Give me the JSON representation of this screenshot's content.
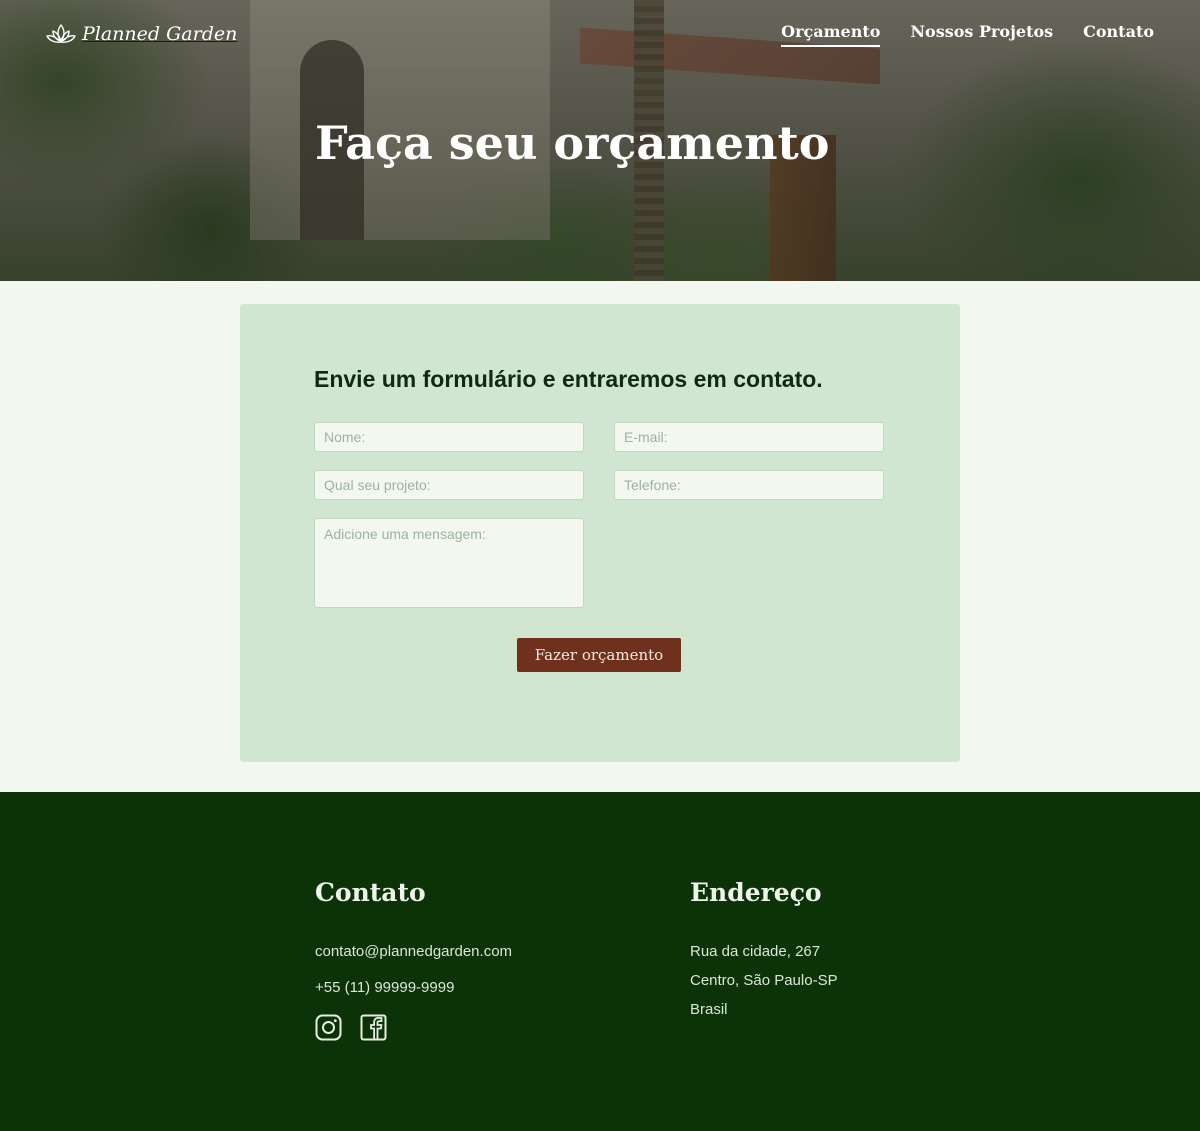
{
  "brand": {
    "name": "Planned Garden",
    "logo_icon": "lotus-icon"
  },
  "nav": {
    "items": [
      {
        "label": "Orçamento",
        "active": true
      },
      {
        "label": "Nossos Projetos",
        "active": false
      },
      {
        "label": "Contato",
        "active": false
      }
    ]
  },
  "hero": {
    "title": "Faça seu orçamento"
  },
  "form": {
    "heading": "Envie um formulário e entraremos em contato.",
    "fields": {
      "name": {
        "placeholder": "Nome:",
        "value": ""
      },
      "email": {
        "placeholder": "E-mail:",
        "value": ""
      },
      "project": {
        "placeholder": "Qual seu projeto:",
        "value": ""
      },
      "phone": {
        "placeholder": "Telefone:",
        "value": ""
      },
      "message": {
        "placeholder": "Adicione uma mensagem:",
        "value": ""
      }
    },
    "submit_label": "Fazer orçamento"
  },
  "footer": {
    "contact": {
      "title": "Contato",
      "email": "contato@plannedgarden.com",
      "phone": "+55 (11) 99999-9999",
      "socials": [
        "instagram-icon",
        "facebook-icon"
      ]
    },
    "address": {
      "title": "Endereço",
      "lines": [
        "Rua da cidade, 267",
        "Centro, São Paulo-SP",
        "Brasil"
      ]
    }
  },
  "colors": {
    "accent": "#6f311d",
    "footer_bg": "#0c3208",
    "card_bg": "#d0e6d0",
    "page_bg": "#f2f7f0"
  }
}
